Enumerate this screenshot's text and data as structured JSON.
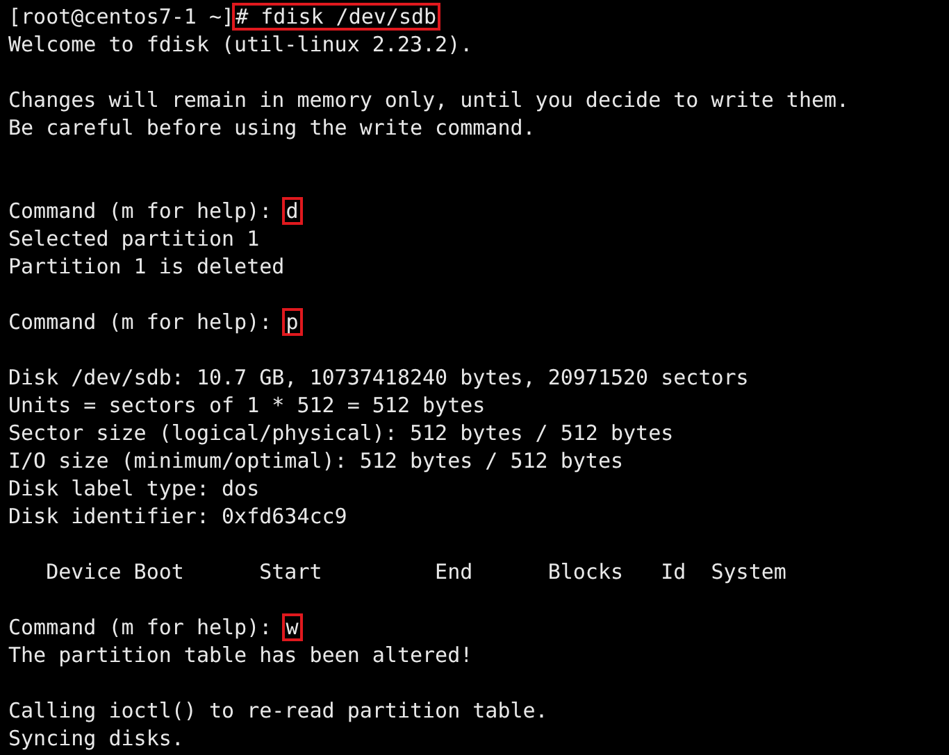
{
  "terminal": {
    "lines": [
      {
        "kind": "command",
        "text": "[root@centos7-1 ~]",
        "input": "# fdisk /dev/sdb"
      },
      {
        "kind": "output",
        "text": "Welcome to fdisk (util-linux 2.23.2)."
      },
      {
        "kind": "blank"
      },
      {
        "kind": "output",
        "text": "Changes will remain in memory only, until you decide to write them."
      },
      {
        "kind": "output",
        "text": "Be careful before using the write command."
      },
      {
        "kind": "blank"
      },
      {
        "kind": "blank"
      },
      {
        "kind": "command",
        "text": "Command (m for help): ",
        "input": "d"
      },
      {
        "kind": "output",
        "text": "Selected partition 1"
      },
      {
        "kind": "output",
        "text": "Partition 1 is deleted"
      },
      {
        "kind": "blank"
      },
      {
        "kind": "command",
        "text": "Command (m for help): ",
        "input": "p"
      },
      {
        "kind": "blank"
      },
      {
        "kind": "output",
        "text": "Disk /dev/sdb: 10.7 GB, 10737418240 bytes, 20971520 sectors"
      },
      {
        "kind": "output",
        "text": "Units = sectors of 1 * 512 = 512 bytes"
      },
      {
        "kind": "output",
        "text": "Sector size (logical/physical): 512 bytes / 512 bytes"
      },
      {
        "kind": "output",
        "text": "I/O size (minimum/optimal): 512 bytes / 512 bytes"
      },
      {
        "kind": "output",
        "text": "Disk label type: dos"
      },
      {
        "kind": "output",
        "text": "Disk identifier: 0xfd634cc9"
      },
      {
        "kind": "blank"
      },
      {
        "kind": "output",
        "text": "   Device Boot      Start         End      Blocks   Id  System"
      },
      {
        "kind": "blank"
      },
      {
        "kind": "command",
        "text": "Command (m for help): ",
        "input": "w"
      },
      {
        "kind": "output",
        "text": "The partition table has been altered!"
      },
      {
        "kind": "blank"
      },
      {
        "kind": "output",
        "text": "Calling ioctl() to re-read partition table."
      },
      {
        "kind": "output",
        "text": "Syncing disks."
      }
    ]
  }
}
